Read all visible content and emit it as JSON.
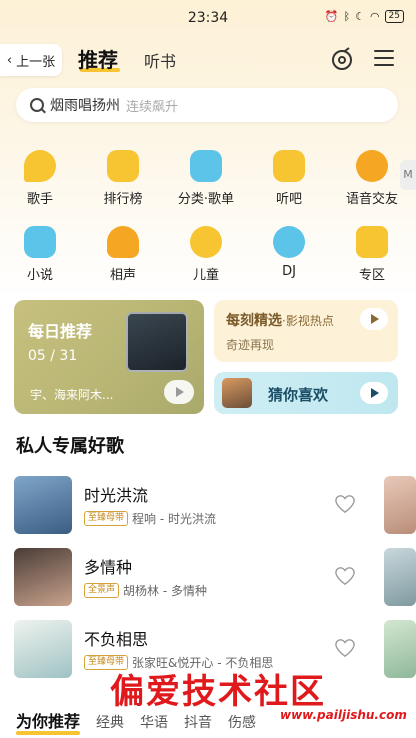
{
  "status_bar": {
    "time": "23:34",
    "battery": "25"
  },
  "header": {
    "back_label": "上一张",
    "tabs": [
      {
        "label": "推荐"
      },
      {
        "label": "听书"
      }
    ]
  },
  "search": {
    "query": "烟雨唱扬州",
    "suggestion": "连续飙升"
  },
  "categories": [
    {
      "label": "歌手",
      "icon": "singer-icon",
      "color": "#f7c531"
    },
    {
      "label": "排行榜",
      "icon": "chart-icon",
      "color": "#f7c531"
    },
    {
      "label": "分类·歌单",
      "icon": "music-note-icon",
      "color": "#5bc4e8"
    },
    {
      "label": "听吧",
      "icon": "radio-icon",
      "color": "#f7c531"
    },
    {
      "label": "语音交友",
      "icon": "chat-icon",
      "color": "#f5a623"
    },
    {
      "label": "小说",
      "icon": "book-icon",
      "color": "#5bc4e8"
    },
    {
      "label": "相声",
      "icon": "fan-icon",
      "color": "#f5a623"
    },
    {
      "label": "儿童",
      "icon": "child-icon",
      "color": "#f7c531"
    },
    {
      "label": "DJ",
      "icon": "disc-icon",
      "color": "#5bc4e8"
    },
    {
      "label": "专区",
      "icon": "grid-icon",
      "color": "#f7c531"
    }
  ],
  "side_tab": "M",
  "daily": {
    "title": "每日推荐",
    "date": "05 / 31",
    "artist": "宇、海来阿木..."
  },
  "moment": {
    "title": "每刻精选",
    "tag": "·影视热点",
    "subtitle": "奇迹再现"
  },
  "guess": {
    "label": "猜你喜欢"
  },
  "section": {
    "title": "私人专属好歌"
  },
  "songs": [
    {
      "name": "时光洪流",
      "badge": "至臻母带",
      "meta": "程响 - 时光洪流"
    },
    {
      "name": "多情种",
      "badge": "全景声",
      "meta": "胡杨林 - 多情种"
    },
    {
      "name": "不负相思",
      "badge": "至臻母带",
      "meta": "张家旺&悦开心 - 不负相思"
    }
  ],
  "bottom_tabs": [
    {
      "label": "为你推荐"
    },
    {
      "label": "经典"
    },
    {
      "label": "华语"
    },
    {
      "label": "抖音"
    },
    {
      "label": "伤感"
    }
  ],
  "watermark": {
    "text": "偏爱技术社区",
    "url": "www.pailjishu.com"
  }
}
